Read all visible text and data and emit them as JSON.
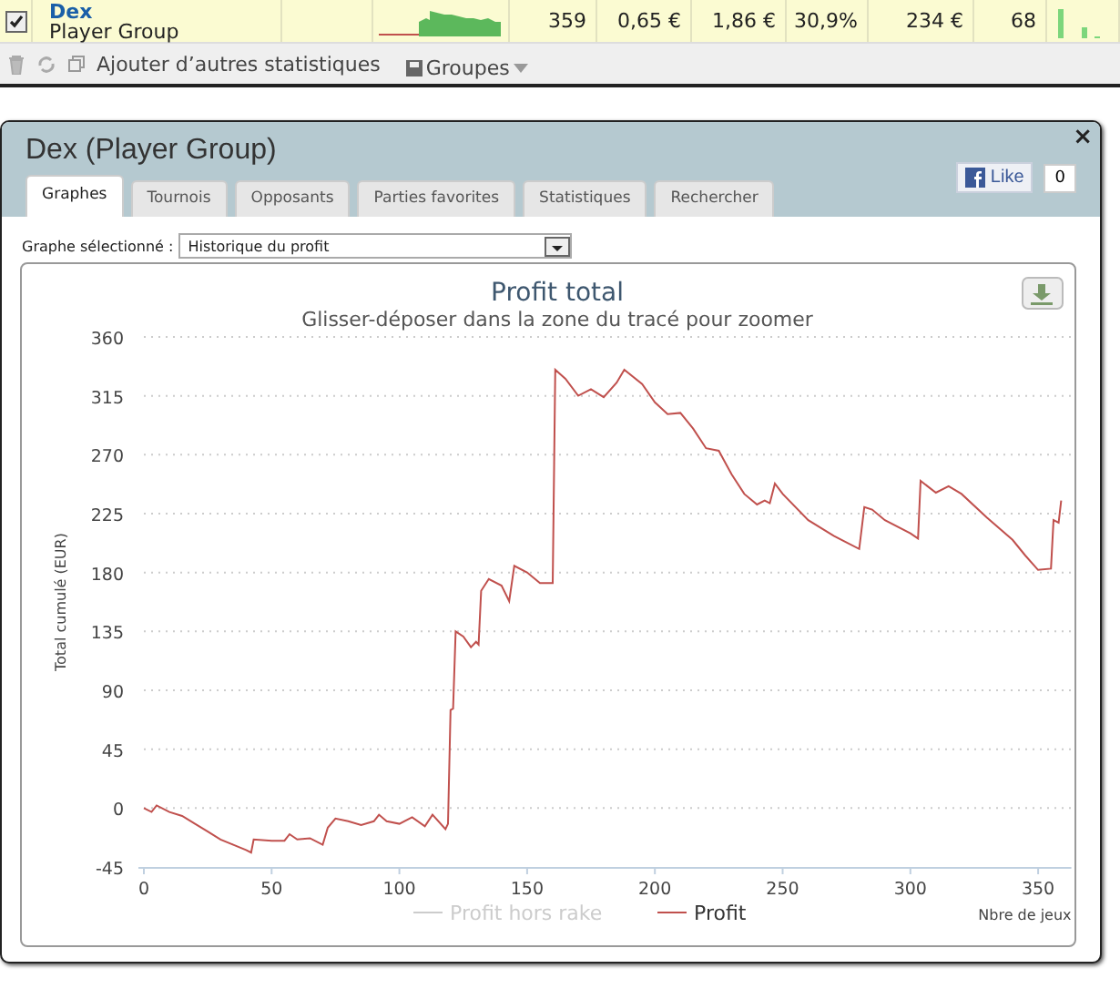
{
  "player_row": {
    "checked": true,
    "name": "Dex",
    "group": "Player Group",
    "cells": [
      "359",
      "0,65 €",
      "1,86 €",
      "30,9%",
      "234 €",
      "68"
    ]
  },
  "toolbar": {
    "add_stats": "Ajouter d’autres statistiques",
    "groups": "Groupes"
  },
  "dialog": {
    "title": "Dex (Player Group)",
    "close": "×",
    "like": {
      "label": "Like",
      "count": "0"
    },
    "tabs": [
      {
        "label": "Graphes",
        "selected": true
      },
      {
        "label": "Tournois",
        "selected": false
      },
      {
        "label": "Opposants",
        "selected": false
      },
      {
        "label": "Parties favorites",
        "selected": false
      },
      {
        "label": "Statistiques",
        "selected": false
      },
      {
        "label": "Rechercher",
        "selected": false
      }
    ],
    "graph_select": {
      "label": "Graphe sélectionné :",
      "value": "Historique du profit"
    },
    "legend": [
      {
        "name": "Profit hors rake",
        "visible": false
      }
    ],
    "chart_data": {
      "type": "line",
      "title": "Profit total",
      "subtitle": "Glisser-déposer dans la zone du tracé pour zoomer",
      "xlabel": "Nbre de jeux",
      "ylabel": "Total cumulé (EUR)",
      "grid": true,
      "xlim": [
        0,
        363
      ],
      "ylim": [
        -45,
        360
      ],
      "xticks": [
        0,
        50,
        100,
        150,
        200,
        250,
        300,
        350
      ],
      "yticks": [
        -45,
        0,
        45,
        90,
        135,
        180,
        225,
        270,
        315,
        360
      ],
      "x": [
        0,
        3,
        5,
        10,
        15,
        20,
        25,
        30,
        35,
        40,
        42,
        43,
        50,
        55,
        57,
        60,
        65,
        70,
        72,
        75,
        80,
        85,
        90,
        92,
        95,
        100,
        105,
        110,
        113,
        118,
        119,
        120,
        121,
        122,
        125,
        128,
        130,
        131,
        132,
        135,
        140,
        143,
        145,
        150,
        155,
        160,
        161,
        165,
        170,
        175,
        180,
        185,
        188,
        195,
        200,
        205,
        210,
        215,
        220,
        225,
        230,
        235,
        240,
        243,
        245,
        247,
        250,
        260,
        270,
        275,
        280,
        282,
        285,
        290,
        300,
        303,
        304,
        310,
        315,
        320,
        330,
        340,
        345,
        350,
        355,
        356,
        358,
        359
      ],
      "series": [
        {
          "name": "Profit",
          "color": "#c0504d",
          "values": [
            0,
            -3,
            2,
            -3,
            -6,
            -12,
            -18,
            -24,
            -28,
            -32,
            -34,
            -24,
            -25,
            -25,
            -20,
            -24,
            -23,
            -28,
            -15,
            -8,
            -10,
            -13,
            -10,
            -5,
            -10,
            -12,
            -7,
            -14,
            -5,
            -16,
            -12,
            75,
            76,
            135,
            131,
            123,
            127,
            125,
            166,
            175,
            170,
            158,
            185,
            180,
            172,
            172,
            335,
            328,
            315,
            320,
            314,
            325,
            335,
            324,
            310,
            301,
            302,
            290,
            275,
            273,
            255,
            240,
            232,
            235,
            233,
            248,
            240,
            220,
            208,
            203,
            198,
            230,
            228,
            220,
            210,
            206,
            250,
            241,
            246,
            240,
            222,
            205,
            193,
            182,
            183,
            220,
            218,
            235
          ]
        }
      ]
    }
  }
}
